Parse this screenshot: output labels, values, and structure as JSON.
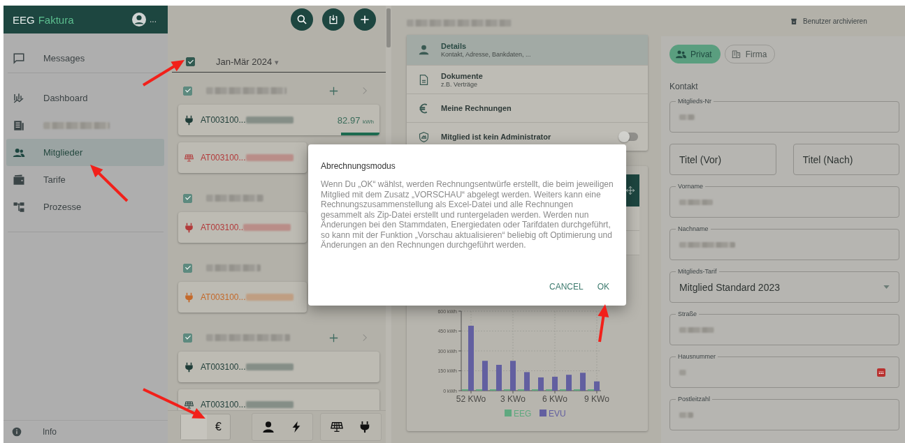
{
  "sidebar": {
    "logo_prefix": "EEG",
    "logo_name": "Faktura",
    "user_menu": "...",
    "items": [
      {
        "label": "Messages",
        "selected": false
      },
      {
        "label": "Dashboard",
        "selected": false
      },
      {
        "redacted": true,
        "selected": false
      },
      {
        "label": "Mitglieder",
        "selected": true
      },
      {
        "label": "Tarife",
        "selected": false
      },
      {
        "label": "Prozesse",
        "selected": false
      }
    ],
    "footer": "Info"
  },
  "member_list": {
    "period": {
      "checked": true,
      "label": "Jan-Mär 2024",
      "caret": "▾"
    },
    "members": [
      {
        "checked": true,
        "actions": true,
        "meters": [
          {
            "kind": "plug",
            "color": "#1f3d38",
            "id": "AT003100...",
            "reading": "82.97",
            "unit": "kWh",
            "level": 0.19
          },
          {
            "kind": "solar",
            "color": "#b23a3a",
            "id": "AT003100..."
          }
        ]
      },
      {
        "checked": true,
        "actions": false,
        "meters": [
          {
            "kind": "plug",
            "color": "#b23a3a",
            "id": "AT003100.."
          }
        ]
      },
      {
        "checked": true,
        "actions": false,
        "meters": [
          {
            "kind": "plug",
            "color": "#c4692a",
            "id": "AT003100..."
          }
        ]
      },
      {
        "checked": true,
        "actions": true,
        "meters": [
          {
            "kind": "plug",
            "color": "#1f3d38",
            "id": "AT003100..."
          },
          {
            "kind": "solar",
            "color": "#1f3d38",
            "id": "AT003100..."
          }
        ]
      }
    ],
    "toolbar": {
      "currency": "€"
    }
  },
  "detail": {
    "menu": [
      {
        "kind": "link",
        "title": "Details",
        "subtitle": "Kontakt, Adresse, Bankdaten, ...",
        "selected": true
      },
      {
        "kind": "link",
        "title": "Dokumente",
        "subtitle": "z.B. Verträge",
        "selected": false
      },
      {
        "kind": "link",
        "title": "Meine Rechnungen",
        "selected": false
      },
      {
        "kind": "toggle",
        "title": "Mitglied ist kein Administrator",
        "on": false
      }
    ],
    "chart_data": {
      "type": "bar",
      "categories": [
        "52 KWo",
        null,
        null,
        "3 KWo",
        null,
        null,
        "6 KWo",
        null,
        null,
        "9 KWo"
      ],
      "ylim": [
        0,
        600
      ],
      "yticks": [
        {
          "value": 0,
          "label": "0 kWh"
        },
        {
          "value": 150,
          "label": "150 kWh"
        },
        {
          "value": 300,
          "label": "300 kWh"
        },
        {
          "value": 450,
          "label": "450 kWh"
        },
        {
          "value": 600,
          "label": "600 kWh"
        }
      ],
      "grid": true,
      "legend": true,
      "series": [
        {
          "name": "EEG",
          "color": "#5fa87f",
          "values": [
            8,
            4,
            4,
            4,
            4,
            8,
            4,
            4,
            4,
            4
          ]
        },
        {
          "name": "EVU",
          "color": "#625fa0",
          "values": [
            490,
            225,
            195,
            225,
            140,
            100,
            105,
            120,
            135,
            70
          ]
        }
      ]
    }
  },
  "form": {
    "archive_label": "Benutzer archivieren",
    "types": [
      {
        "label": "Privat",
        "selected": true
      },
      {
        "label": "Firma",
        "selected": false
      }
    ],
    "section": "Kontakt",
    "rows": [
      [
        {
          "kind": "text",
          "label": "Mitglieds-Nr"
        }
      ],
      [
        {
          "kind": "empty",
          "placeholder": "Titel (Vor)"
        },
        {
          "kind": "empty",
          "placeholder": "Titel (Nach)"
        }
      ],
      [
        {
          "kind": "text",
          "label": "Vorname"
        }
      ],
      [
        {
          "kind": "text",
          "label": "Nachname"
        }
      ],
      [
        {
          "kind": "select",
          "label": "Mitglieds-Tarif",
          "value": "Mitglied Standard 2023"
        }
      ],
      [
        {
          "kind": "text",
          "label": "Straße"
        }
      ],
      [
        {
          "kind": "text",
          "label": "Hausnummer",
          "warning": true
        }
      ],
      [
        {
          "kind": "text",
          "label": "Postleitzahl"
        }
      ]
    ]
  },
  "dialog": {
    "title": "Abrechnungsmodus",
    "body": "Wenn Du „OK“ wählst, werden Rechnungsentwürfe erstellt, die beim jeweiligen Mitglied mit dem Zusatz „VORSCHAU“ abgelegt werden. Weiters kann eine Rechnungszusammenstellung als Excel-Datei und alle Rechnungen gesammelt als Zip-Datei erstellt und runtergeladen werden. Werden nun Änderungen bei den Stammdaten, Energiedaten oder Tarifdaten durchgeführt, so kann mit der Funktion „Vorschau aktualisieren“ beliebig oft Optimierung und Änderungen an den Rechnungen durchgeführt werden.",
    "buttons": [
      "CANCEL",
      "OK"
    ]
  }
}
